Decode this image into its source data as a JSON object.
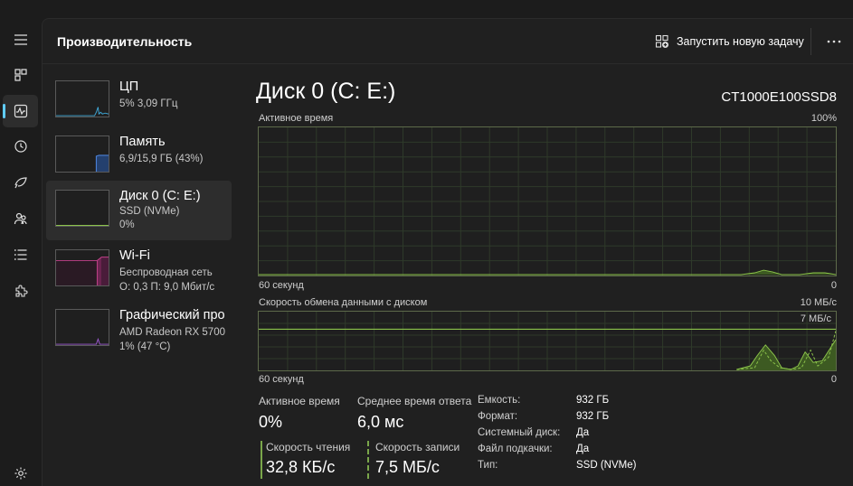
{
  "header": {
    "title": "Производительность",
    "run_task_label": "Запустить новую задачу",
    "more_label": "···"
  },
  "devices": [
    {
      "title": "ЦП",
      "line1": "5% 3,09 ГГц",
      "line2": ""
    },
    {
      "title": "Память",
      "line1": "6,9/15,9 ГБ (43%)",
      "line2": ""
    },
    {
      "title": "Диск 0 (C: E:)",
      "line1": "SSD (NVMe)",
      "line2": "0%"
    },
    {
      "title": "Wi-Fi",
      "line1": "Беспроводная сеть",
      "line2": "О: 0,3 П: 9,0 Мбит/с"
    },
    {
      "title": "Графический про",
      "line1": "AMD Radeon RX 5700",
      "line2": "1% (47 °C)"
    }
  ],
  "disk": {
    "title": "Диск 0 (C: E:)",
    "model": "CT1000E100SSD8",
    "active_graph": {
      "label": "Активное время",
      "max": "100%",
      "time": "60 секунд",
      "min": "0"
    },
    "transfer_graph": {
      "label": "Скорость обмена данными с диском",
      "max": "10 МБ/с",
      "ref": "7 МБ/с",
      "time": "60 секунд",
      "min": "0"
    },
    "stats": {
      "active_time_label": "Активное время",
      "active_time_value": "0%",
      "response_label": "Среднее время ответа",
      "response_value": "6,0 мс",
      "read_label": "Скорость чтения",
      "read_value": "32,8 КБ/с",
      "write_label": "Скорость записи",
      "write_value": "7,5 МБ/с"
    },
    "properties": [
      {
        "key": "Емкость:",
        "value": "932 ГБ"
      },
      {
        "key": "Формат:",
        "value": "932 ГБ"
      },
      {
        "key": "Системный диск:",
        "value": "Да"
      },
      {
        "key": "Файл подкачки:",
        "value": "Да"
      },
      {
        "key": "Тип:",
        "value": "SSD (NVMe)"
      }
    ]
  },
  "colors": {
    "accent": "#60cdff",
    "disk_green": "#8bc34a",
    "memory_blue": "#4a7fd4",
    "wifi_pink": "#c2418a",
    "gpu_purple": "#9b59d0"
  }
}
